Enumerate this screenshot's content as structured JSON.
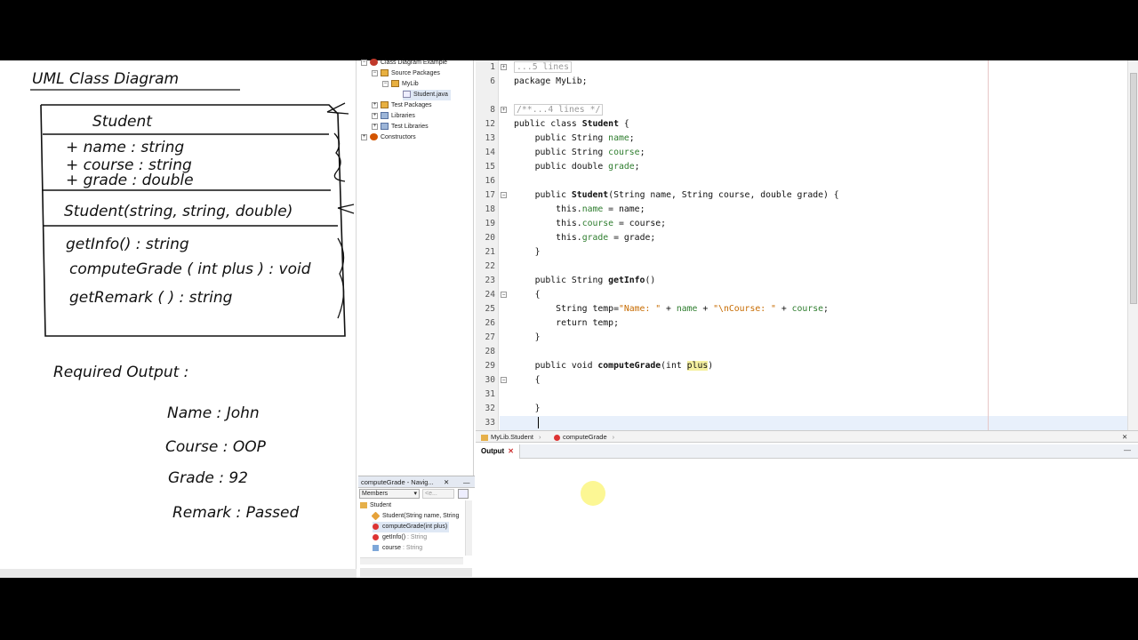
{
  "whiteboard": {
    "title": "UML Class Diagram",
    "class_name": "Student",
    "attributes": [
      "+ name : string",
      "+ course : string",
      "+ grade : double"
    ],
    "constructor": "Student(string, string, double)",
    "methods": [
      "getInfo() : string",
      "computeGrade ( int plus ) : void",
      "getRemark ( ) : string"
    ],
    "required_label": "Required  Output :",
    "outputs": [
      "Name : John",
      "Course : OOP",
      "Grade : 92",
      "Remark : Passed"
    ]
  },
  "project_tree": {
    "items": [
      "Class Diagram Example",
      "Source Packages",
      "MyLib",
      "Student.java",
      "Test Packages",
      "Libraries",
      "Test Libraries",
      "Constructors"
    ]
  },
  "editor": {
    "line_numbers": [
      "1",
      "6",
      "8",
      "12",
      "13",
      "14",
      "15",
      "16",
      "17",
      "18",
      "19",
      "20",
      "21",
      "22",
      "23",
      "24",
      "25",
      "26",
      "27",
      "28",
      "29",
      "30",
      "31",
      "32",
      "33"
    ],
    "folded_header": "...5 lines",
    "package_line": "package MyLib;",
    "folded_doc": "/**...4 lines */",
    "code": {
      "l12a": "public class ",
      "l12b": "Student",
      "l12c": " {",
      "l13a": "    public String ",
      "l13b": "name",
      "l13c": ";",
      "l14a": "    public String ",
      "l14b": "course",
      "l14c": ";",
      "l15a": "    public double ",
      "l15b": "grade",
      "l15c": ";",
      "l17a": "    public ",
      "l17b": "Student",
      "l17c": "(String name, String course, double grade) {",
      "l18a": "        this.",
      "l18b": "name",
      "l18c": " = name;",
      "l19a": "        this.",
      "l19b": "course",
      "l19c": " = course;",
      "l20a": "        this.",
      "l20b": "grade",
      "l20c": " = grade;",
      "l21": "    }",
      "l23a": "    public String ",
      "l23b": "getInfo",
      "l23c": "()",
      "l24": "    {",
      "l25a": "        String temp=",
      "l25b": "\"Name: \"",
      "l25c": " + ",
      "l25d": "name",
      "l25e": " + ",
      "l25f": "\"\\nCourse: \"",
      "l25g": " + ",
      "l25h": "course",
      "l25i": ";",
      "l26": "        return temp;",
      "l27": "    }",
      "l29a": "    public void ",
      "l29b": "computeGrade",
      "l29c": "(int ",
      "l29d": "plus",
      "l29e": ")",
      "l30": "    {",
      "l32": "    }"
    }
  },
  "breadcrumb": {
    "items": [
      "MyLib.Student",
      "computeGrade"
    ]
  },
  "output_panel": {
    "tab_label": "Output"
  },
  "navigator": {
    "title": "computeGrade - Navig...",
    "filter_label": "Members",
    "filter2": "<e...",
    "root": "Student",
    "members": [
      {
        "name": "Student(String name, String",
        "type": ""
      },
      {
        "name": "computeGrade(int plus)",
        "type": ""
      },
      {
        "name": "getInfo()",
        "type": " : String"
      },
      {
        "name": "course",
        "type": " : String"
      }
    ]
  },
  "colors": {
    "field": "#2e7d2e",
    "string": "#c76b00",
    "highlight": "#f5f0a0",
    "current_line": "#e8f0fb"
  }
}
